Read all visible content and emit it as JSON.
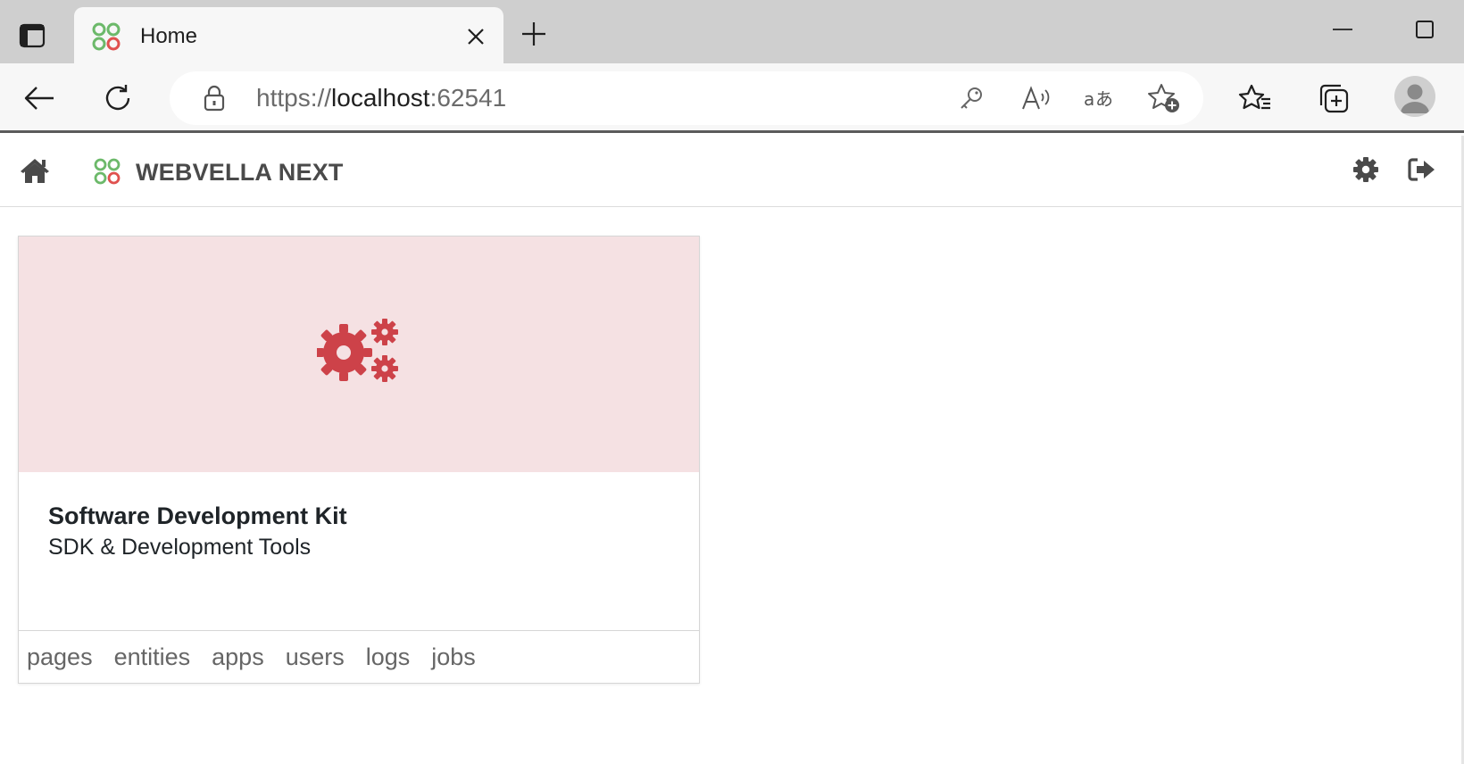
{
  "browser": {
    "tab": {
      "title": "Home"
    },
    "address": {
      "scheme": "https://",
      "host": "localhost",
      "port": ":62541"
    }
  },
  "app": {
    "brand": "WEBVELLA NEXT"
  },
  "card": {
    "title": "Software Development Kit",
    "subtitle": "SDK & Development Tools",
    "accent_color": "#cd4249",
    "media_background": "#f5e1e3",
    "links": [
      "pages",
      "entities",
      "apps",
      "users",
      "logs",
      "jobs"
    ]
  },
  "icons": {
    "tab_actions": "tab-actions-icon",
    "favicon": "webvella-logo-icon",
    "close": "close-icon",
    "new_tab": "plus-icon",
    "back": "back-arrow-icon",
    "refresh": "refresh-icon",
    "lock": "lock-icon",
    "key": "key-icon",
    "read_aloud": "read-aloud-icon",
    "translate": "translate-icon",
    "add_favorite": "add-favorite-icon",
    "favorites": "favorites-icon",
    "collections": "collections-icon",
    "profile": "profile-icon",
    "home": "home-icon",
    "settings": "gear-icon",
    "logout": "logout-icon",
    "card_icon": "cogs-icon"
  }
}
